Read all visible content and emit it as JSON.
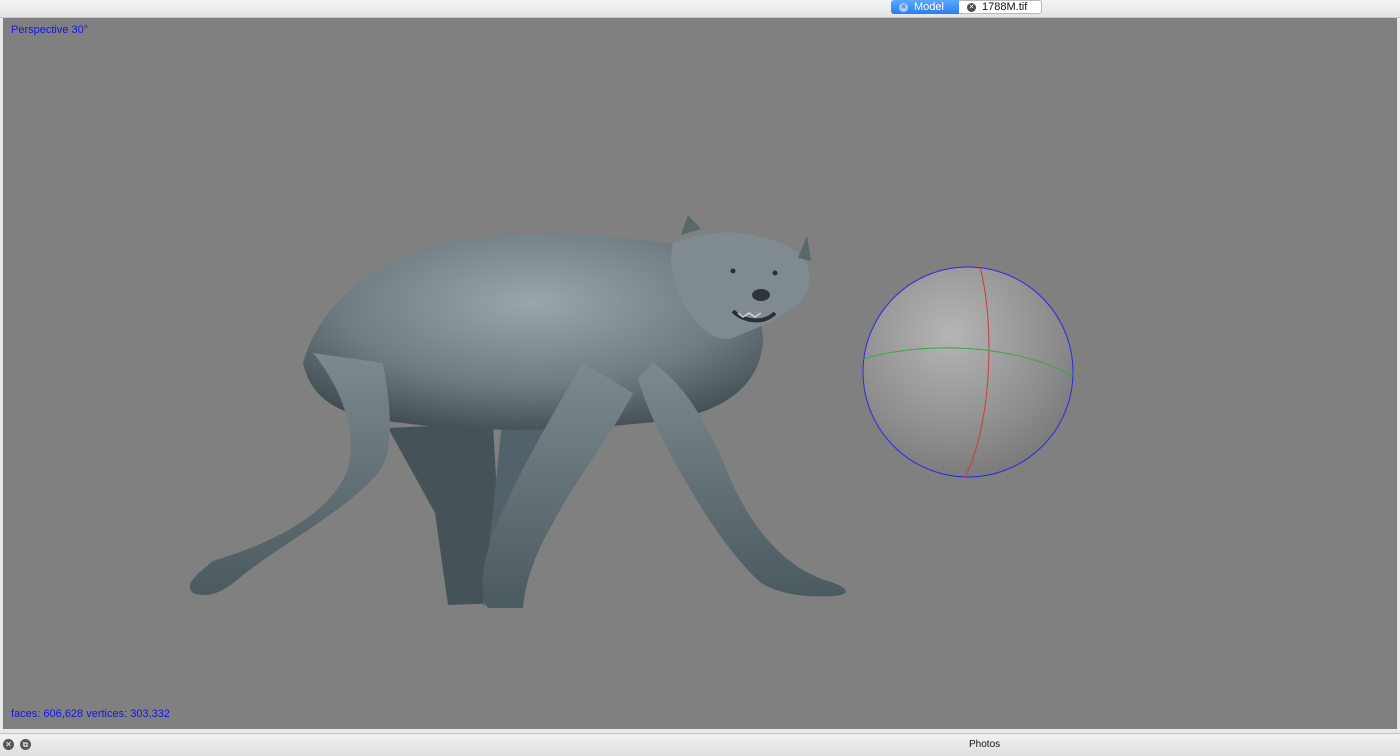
{
  "tabs": [
    {
      "label": "Model",
      "active": true
    },
    {
      "label": "1788M.tif",
      "active": false
    }
  ],
  "viewport": {
    "projection_label": "Perspective 30°",
    "stats_label": "faces: 606,628 vertices: 303,332",
    "background_color": "#808080",
    "overlay_text_color": "#1515e6"
  },
  "trackball": {
    "axis_colors": {
      "x": "#2a2ae6",
      "y": "#d13a3a",
      "z": "#3aa64a"
    }
  },
  "bottom_panel": {
    "title": "Photos"
  }
}
